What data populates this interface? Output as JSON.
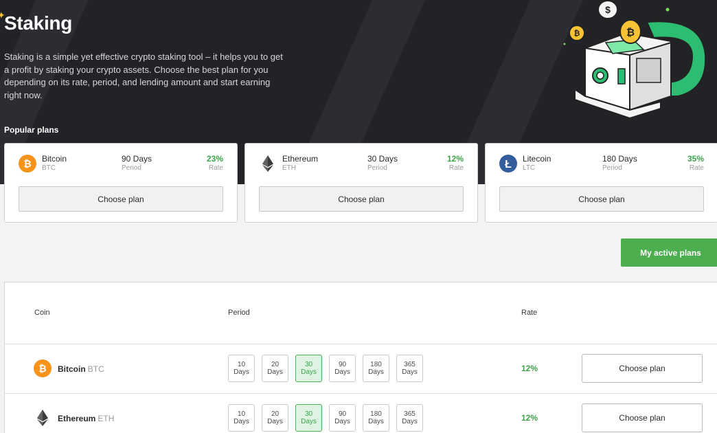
{
  "header": {
    "title": "Staking",
    "description": "Staking is a simple yet effective crypto staking tool – it helps you to get a profit by staking your crypto assets. Choose the best plan for you depending on its rate, period, and lending amount and start earning right now.",
    "popular_label": "Popular plans"
  },
  "popular_plans": [
    {
      "coin": "Bitcoin",
      "symbol": "BTC",
      "icon": "bitcoin-icon",
      "days": "90 Days",
      "days_label": "Period",
      "rate": "23%",
      "rate_label": "Rate",
      "button": "Choose plan"
    },
    {
      "coin": "Ethereum",
      "symbol": "ETH",
      "icon": "ethereum-icon",
      "days": "30 Days",
      "days_label": "Period",
      "rate": "12%",
      "rate_label": "Rate",
      "button": "Choose plan"
    },
    {
      "coin": "Litecoin",
      "symbol": "LTC",
      "icon": "litecoin-icon",
      "days": "180 Days",
      "days_label": "Period",
      "rate": "35%",
      "rate_label": "Rate",
      "button": "Choose plan"
    }
  ],
  "active_plans_button": "My active plans",
  "table": {
    "headers": {
      "coin": "Coin",
      "period": "Period",
      "rate": "Rate"
    },
    "rows": [
      {
        "coin": "Bitcoin",
        "symbol": "BTC",
        "icon": "bitcoin-icon",
        "periods": [
          {
            "num": "10",
            "unit": "Days"
          },
          {
            "num": "20",
            "unit": "Days"
          },
          {
            "num": "30",
            "unit": "Days"
          },
          {
            "num": "90",
            "unit": "Days"
          },
          {
            "num": "180",
            "unit": "Days"
          },
          {
            "num": "365",
            "unit": "Days"
          }
        ],
        "selected_period": "30",
        "rate": "12%",
        "button": "Choose plan"
      },
      {
        "coin": "Ethereum",
        "symbol": "ETH",
        "icon": "ethereum-icon",
        "periods": [
          {
            "num": "10",
            "unit": "Days"
          },
          {
            "num": "20",
            "unit": "Days"
          },
          {
            "num": "30",
            "unit": "Days"
          },
          {
            "num": "90",
            "unit": "Days"
          },
          {
            "num": "180",
            "unit": "Days"
          },
          {
            "num": "365",
            "unit": "Days"
          }
        ],
        "selected_period": "30",
        "rate": "12%",
        "button": "Choose plan"
      }
    ]
  },
  "colors": {
    "accent_green": "#4cae4f",
    "rate_green": "#3aa447",
    "hero_bg": "#222327",
    "bitcoin_orange": "#f7931a",
    "litecoin_blue": "#345d9d"
  }
}
